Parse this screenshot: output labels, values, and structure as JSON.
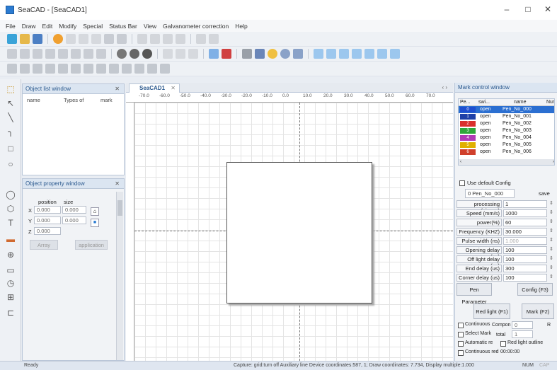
{
  "window": {
    "title": "SeaCAD - [SeaCAD1]",
    "minimize": "–",
    "maximize": "□",
    "close": "✕"
  },
  "menu": [
    "File",
    "Draw",
    "Edit",
    "Modify",
    "Special",
    "Status Bar",
    "View",
    "Galvanometer correction",
    "Help"
  ],
  "object_list": {
    "title": "Object list window",
    "close": "✕",
    "cols": [
      "name",
      "Types of",
      "mark"
    ]
  },
  "object_property": {
    "title": "Object property window",
    "close": "✕",
    "position_label": "position",
    "size_label": "size",
    "x_label": "X",
    "y_label": "Y",
    "z_label": "Z",
    "x_pos": "0.000",
    "y_pos": "0.000",
    "z_pos": "0.000",
    "x_size": "0.000",
    "y_size": "0.000",
    "array_btn": "Array",
    "apply_btn": "application"
  },
  "document": {
    "tab": "SeaCAD1",
    "tab_close": "✕",
    "nav": "‹ ›",
    "ruler_ticks": [
      "-70.0",
      "-60.0",
      "-50.0",
      "-40.0",
      "-30.0",
      "-20.0",
      "-10.0",
      "0.0",
      "10.0",
      "20.0",
      "30.0",
      "40.0",
      "50.0",
      "60.0",
      "70.0"
    ]
  },
  "mark_control": {
    "title": "Mark control window",
    "cols": [
      "Pe...",
      "swi...",
      "name",
      "Nur"
    ],
    "pens": [
      {
        "num": "0",
        "state": "open",
        "name": "Pen_No_000",
        "color": "#1f4fd0"
      },
      {
        "num": "1",
        "state": "open",
        "name": "Pen_No_001",
        "color": "#1e40a8"
      },
      {
        "num": "2",
        "state": "open",
        "name": "Pen_No_002",
        "color": "#d9302c"
      },
      {
        "num": "3",
        "state": "open",
        "name": "Pen_No_003",
        "color": "#2fa83a"
      },
      {
        "num": "4",
        "state": "open",
        "name": "Pen_No_004",
        "color": "#b23bb5"
      },
      {
        "num": "5",
        "state": "open",
        "name": "Pen_No_005",
        "color": "#e0b000"
      },
      {
        "num": "6",
        "state": "open",
        "name": "Pen_No_006",
        "color": "#d0402c"
      }
    ],
    "use_default": "Use default Config",
    "pen_num": "0",
    "pen_name": "Pen_No_000",
    "save": "save",
    "params": [
      {
        "label": "processing (pieces)",
        "value": "1"
      },
      {
        "label": "Speed (mm/s)",
        "value": "1000"
      },
      {
        "label": "power(%)",
        "value": "60"
      },
      {
        "label": "Frequency (KHZ)",
        "value": "30.000"
      },
      {
        "label": "Pulse width (ns)",
        "value": "1.000"
      },
      {
        "label": "Opening delay (us)",
        "value": "100"
      },
      {
        "label": "Off light delay (us)",
        "value": "100"
      },
      {
        "label": "End delay (us)",
        "value": "300"
      },
      {
        "label": "Corner delay (us)",
        "value": "100"
      }
    ],
    "pen_param_btn": "Pen Parameter",
    "config_btn": "Config (F3)",
    "redlight_btn": "Red light (F1)",
    "mark_btn": "Mark (F2)",
    "continuous": "Continuous",
    "component": "Compon",
    "component_val": "0",
    "r": "R",
    "select_mark": "Select Mark",
    "total": "total",
    "total_val": "1",
    "automatic": "Automatic re",
    "red_outline": "Red light outline",
    "continuous_red": "Continuous red",
    "time": "00:00:00"
  },
  "status": {
    "ready": "Ready",
    "info": "Capture: grid:turn off Auxiliary line Device coordinates:587, 1; Draw coordinates: 7.734, Display multiple:1.000",
    "num": "NUM",
    "cap": "CAP"
  },
  "colors": {
    "accent": "#2b7bd1",
    "panel_header": "#dbe5f1"
  }
}
